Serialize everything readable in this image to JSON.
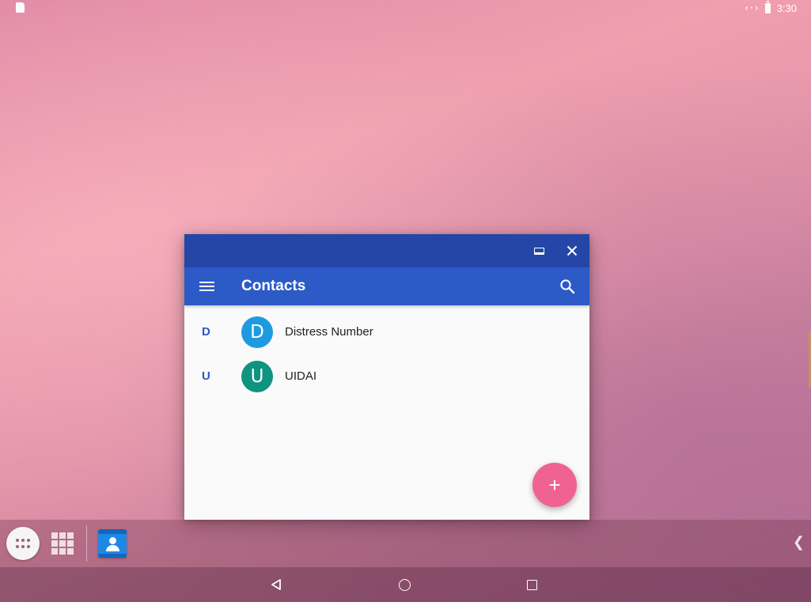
{
  "status_bar": {
    "time": "3:30",
    "icons": [
      "sd-card-icon",
      "ethernet-icon",
      "battery-charging-icon"
    ]
  },
  "window": {
    "caption_buttons": [
      "maximize-icon",
      "close-icon"
    ],
    "app_bar": {
      "title": "Contacts",
      "menu_icon": "hamburger-menu-icon",
      "search_icon": "search-icon",
      "color": "#2c5ac7",
      "caption_color": "#2447a7"
    },
    "contacts": [
      {
        "section": "D",
        "initial": "D",
        "name": "Distress Number",
        "avatar_color": "#1e9be0"
      },
      {
        "section": "U",
        "initial": "U",
        "name": "UIDAI",
        "avatar_color": "#0f9480"
      }
    ],
    "fab": {
      "label": "+",
      "color": "#f06292"
    }
  },
  "taskbar": {
    "all_apps_icon": "app-drawer-icon",
    "recents_icon": "grid-icon",
    "pinned_apps": [
      "contacts-app-icon"
    ],
    "collapse_label": "❮"
  },
  "nav_bar": {
    "buttons": [
      "back-icon",
      "home-icon",
      "recents-icon"
    ]
  }
}
